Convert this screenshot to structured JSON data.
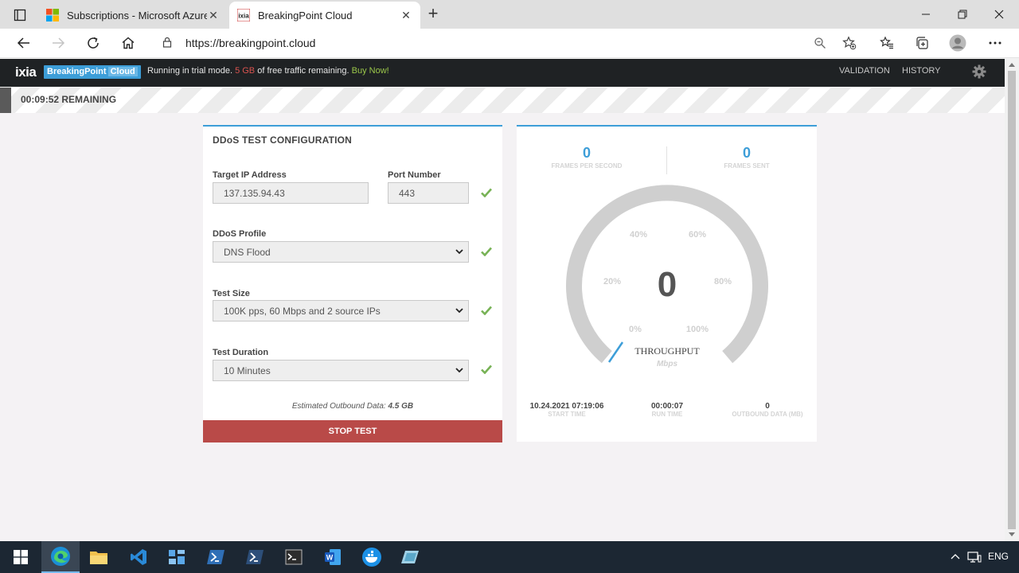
{
  "browser": {
    "tabs": [
      {
        "title": "Subscriptions - Microsoft Azure",
        "close": "✕"
      },
      {
        "title": "BreakingPoint Cloud",
        "close": "✕"
      }
    ],
    "new_tab": "+",
    "url": "https://breakingpoint.cloud",
    "window_controls": [
      "minimize-icon",
      "restore-icon",
      "close-icon"
    ]
  },
  "header": {
    "logo": "ixia",
    "product": "BreakingPoint",
    "product_suffix": "Cloud",
    "trial_prefix": "Running in trial mode.",
    "trial_gb": "5 GB",
    "trial_mid": "of free traffic remaining.",
    "buy": "Buy Now!",
    "nav": [
      "VALIDATION",
      "HISTORY"
    ]
  },
  "timer": {
    "text": "00:09:52 REMAINING"
  },
  "config": {
    "title": "DDoS TEST CONFIGURATION",
    "target_ip_label": "Target IP Address",
    "target_ip": "137.135.94.43",
    "port_label": "Port Number",
    "port": "443",
    "profile_label": "DDoS Profile",
    "profile": "DNS Flood",
    "size_label": "Test Size",
    "size": "100K pps, 60 Mbps and 2 source IPs",
    "duration_label": "Test Duration",
    "duration": "10 Minutes",
    "estimate_label": "Estimated Outbound Data:",
    "estimate_value": "4.5 GB",
    "stop_button": "STOP TEST",
    "valid_color": "#77b255"
  },
  "throughput": {
    "fps_value": "0",
    "fps_label": "FRAMES PER SECOND",
    "sent_value": "0",
    "sent_label": "FRAMES SENT",
    "gauge_value": "0",
    "gauge_fraction": 0.0,
    "gauge_ticks": [
      "0%",
      "20%",
      "40%",
      "60%",
      "80%",
      "100%"
    ],
    "gauge_title": "THROUGHPUT",
    "gauge_unit": "Mbps",
    "start_time": "10.24.2021 07:19:06",
    "start_time_label": "START TIME",
    "run_time": "00:00:07",
    "run_time_label": "RUN TIME",
    "outbound": "0",
    "outbound_label": "OUTBOUND DATA (MB)",
    "accent": "#3d9ed8"
  },
  "taskbar": {
    "items": [
      "start-icon",
      "edge-icon",
      "file-explorer-icon",
      "vscode-icon",
      "app-icon",
      "powershell-icon",
      "powershell-alt-icon",
      "terminal-icon",
      "word-icon",
      "docker-icon",
      "app-alt-icon"
    ],
    "language": "ENG"
  }
}
